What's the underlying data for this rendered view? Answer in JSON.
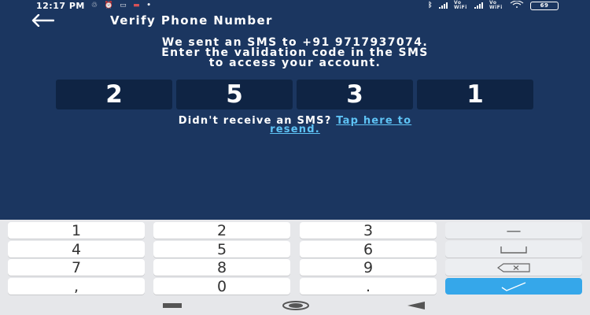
{
  "status_bar": {
    "time": "12:17 PM",
    "icons_left": [
      "notification-icon",
      "alarm-icon",
      "message-icon",
      "app-icon",
      "dot-icon"
    ],
    "icons_right": [
      "bluetooth-icon",
      "signal-icon",
      "volte-wifi-icon",
      "signal-icon",
      "volte-wifi-icon",
      "wifi-icon",
      "battery-icon"
    ],
    "volte_label": "Vo WiFi",
    "battery": "69"
  },
  "header": {
    "back_icon": "back-arrow-icon",
    "title": "Verify Phone Number"
  },
  "message": {
    "line1": "We sent an SMS to +91 9717937074.",
    "line2": "Enter the validation code in the SMS",
    "line3": "to access your account."
  },
  "code": {
    "digits": [
      "2",
      "5",
      "3",
      "1"
    ]
  },
  "resend": {
    "prompt": "Didn't receive an SMS?",
    "link_line1": "Tap here to",
    "link_line2": "resend."
  },
  "keyboard": {
    "rows": [
      [
        "1",
        "2",
        "3",
        "—"
      ],
      [
        "4",
        "5",
        "6",
        "space"
      ],
      [
        "7",
        "8",
        "9",
        "backspace"
      ],
      [
        ",",
        "0",
        ".",
        "done"
      ]
    ],
    "accent_color": "#35a7ea"
  },
  "navbar": {
    "buttons": [
      "recents-icon",
      "home-icon",
      "back-icon"
    ]
  },
  "colors": {
    "background": "#1b3660",
    "code_box": "#0f2444",
    "link": "#5ec3f5",
    "keyboard_bg": "#e6e7ea"
  }
}
